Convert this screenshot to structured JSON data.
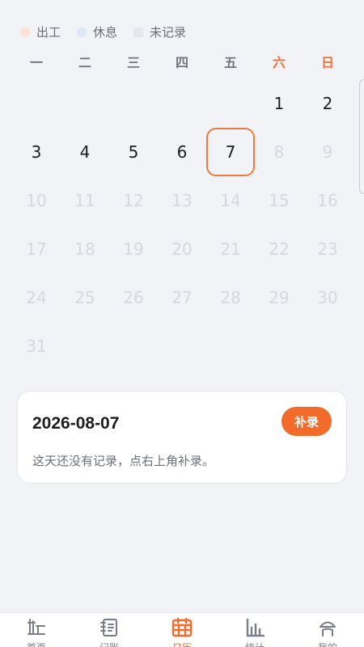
{
  "legend": [
    {
      "label": "出工",
      "color": "#fbe3d6"
    },
    {
      "label": "休息",
      "color": "#dde8f6"
    },
    {
      "label": "未记录",
      "color": "#e6e7ec"
    }
  ],
  "weekdays": [
    "一",
    "二",
    "三",
    "四",
    "五",
    "六",
    "日"
  ],
  "calendar": {
    "leading_blank_days": 5,
    "days": [
      "1",
      "2",
      "3",
      "4",
      "5",
      "6",
      "7",
      "8",
      "9",
      "10",
      "11",
      "12",
      "13",
      "14",
      "15",
      "16",
      "17",
      "18",
      "19",
      "20",
      "21",
      "22",
      "23",
      "24",
      "25",
      "26",
      "27",
      "28",
      "29",
      "30",
      "31"
    ],
    "selected_day": "7",
    "last_active_day": 7
  },
  "card": {
    "date": "2026-08-07",
    "button_label": "补录",
    "hint": "这天还没有记录，点右上角补录。"
  },
  "nav": {
    "items": [
      {
        "name": "home",
        "label": "首页",
        "icon": "home-icon"
      },
      {
        "name": "ledger",
        "label": "记账",
        "icon": "ledger-icon"
      },
      {
        "name": "calendar",
        "label": "日历",
        "icon": "calendar-icon"
      },
      {
        "name": "stats",
        "label": "统计",
        "icon": "chart-icon"
      },
      {
        "name": "mine",
        "label": "我的",
        "icon": "user-icon"
      }
    ],
    "active": "calendar"
  },
  "colors": {
    "accent": "#f26b2a",
    "weekend": "#f07038",
    "inactive_day": "#d5d8df"
  }
}
